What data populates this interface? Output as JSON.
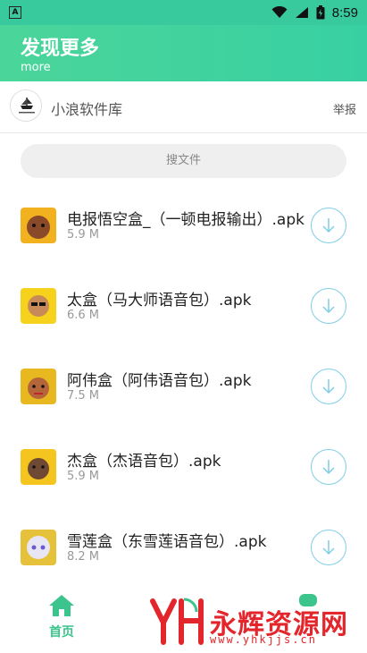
{
  "status_bar": {
    "time": "8:59",
    "app_icon_letter": "A"
  },
  "header": {
    "title": "发现更多",
    "subtitle": "more"
  },
  "account": {
    "name": "小浪软件库",
    "report_label": "举报"
  },
  "search": {
    "placeholder": "搜文件"
  },
  "files": [
    {
      "name": "电报悟空盒_（一顿电报输出）.apk",
      "size": "5.9 M",
      "thumb_color": "#f2b21f"
    },
    {
      "name": "太盒（马大师语音包）.apk",
      "size": "6.6 M",
      "thumb_color": "#f7d21c"
    },
    {
      "name": "阿伟盒（阿伟语音包）.apk",
      "size": "7.5 M",
      "thumb_color": "#e7b820"
    },
    {
      "name": "杰盒（杰语音包）.apk",
      "size": "5.9 M",
      "thumb_color": "#f4c51f"
    },
    {
      "name": "雪莲盒（东雪莲语音包）.apk",
      "size": "8.2 M",
      "thumb_color": "#e6c23a"
    }
  ],
  "bottom_nav": {
    "home_label": "首页"
  },
  "watermark": {
    "text": "永辉资源网",
    "url": "www.yhkjjs.cn"
  },
  "colors": {
    "accent": "#3bc48b",
    "header": "#42d29e",
    "download_ring": "#7fcde6"
  }
}
